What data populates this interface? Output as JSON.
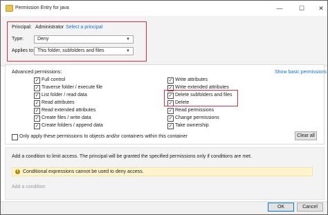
{
  "window": {
    "title": "Permission Entry for java",
    "minimize_glyph": "—",
    "maximize_glyph": "☐",
    "close_glyph": "✕"
  },
  "principal": {
    "label": "Principal:",
    "value": "Administrator",
    "select_link": "Select a principal"
  },
  "type": {
    "label": "Type:",
    "value": "Deny"
  },
  "applies_to": {
    "label": "Applies to:",
    "value": "This folder, subfolders and files"
  },
  "advanced": {
    "heading": "Advanced permissions:",
    "show_basic_link": "Show basic permissions",
    "left_items": [
      {
        "label": "Full control",
        "checked": true
      },
      {
        "label": "Traverse folder / execute file",
        "checked": true
      },
      {
        "label": "List folder / read data",
        "checked": true
      },
      {
        "label": "Read attributes",
        "checked": true
      },
      {
        "label": "Read extended attributes",
        "checked": true
      },
      {
        "label": "Create files / write data",
        "checked": true
      },
      {
        "label": "Create folders / append data",
        "checked": true
      }
    ],
    "right_items": [
      {
        "label": "Write attributes",
        "checked": true
      },
      {
        "label": "Write extended attributes",
        "checked": true
      },
      {
        "label": "Delete subfolders and files",
        "checked": true
      },
      {
        "label": "Delete",
        "checked": true
      },
      {
        "label": "Read permissions",
        "checked": true
      },
      {
        "label": "Change permissions",
        "checked": true
      },
      {
        "label": "Take ownership",
        "checked": true
      }
    ],
    "only_apply_label": "Only apply these permissions to objects and/or containers within this container",
    "only_apply_checked": false,
    "clear_all": "Clear all"
  },
  "conditions": {
    "description": "Add a condition to limit access. The principal will be granted the specified permissions only if conditions are met.",
    "warning": "Conditional expressions cannot be used to deny access.",
    "add_link": "Add a condition"
  },
  "footer": {
    "ok": "OK",
    "cancel": "Cancel"
  },
  "colors": {
    "highlight_border": "#d6303f",
    "link": "#1a6ec7",
    "warning_bg": "#fff4ce"
  }
}
